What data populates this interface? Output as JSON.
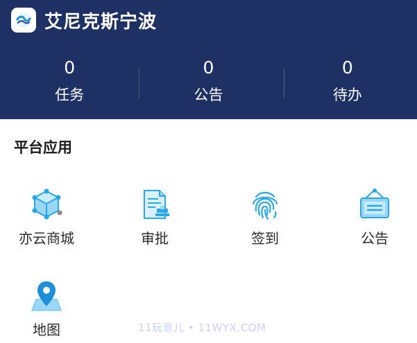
{
  "header": {
    "app_title": "艾尼克斯宁波",
    "logo_icon": "wave-logo-icon",
    "bg_color": "#1e3164"
  },
  "stats": [
    {
      "count": "0",
      "label": "任务"
    },
    {
      "count": "0",
      "label": "公告"
    },
    {
      "count": "0",
      "label": "待办"
    }
  ],
  "section": {
    "title": "平台应用"
  },
  "apps": [
    {
      "label": "亦云商城",
      "icon": "cube-network-icon"
    },
    {
      "label": "审批",
      "icon": "approval-document-icon"
    },
    {
      "label": "签到",
      "icon": "fingerprint-icon"
    },
    {
      "label": "公告",
      "icon": "notice-board-icon"
    },
    {
      "label": "地图",
      "icon": "map-pin-icon"
    }
  ],
  "watermark": "11玩意儿 • 11WYX.COM",
  "accent_color": "#2aa7e8"
}
